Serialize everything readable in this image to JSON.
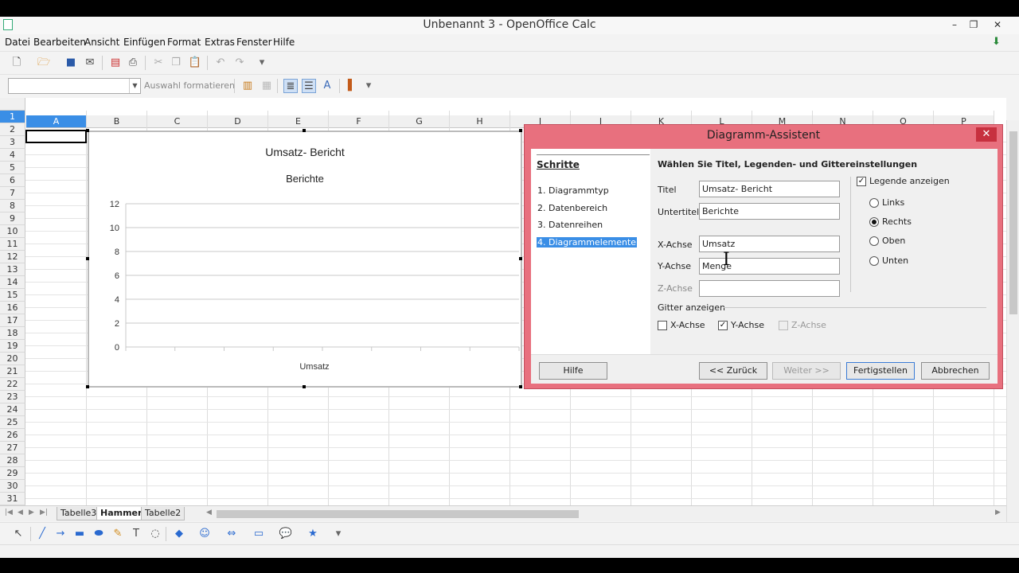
{
  "window": {
    "title": "Unbenannt 3 - OpenOffice Calc",
    "min": "–",
    "restore": "❐",
    "close": "✕"
  },
  "menu": [
    "Datei",
    "Bearbeiten",
    "Ansicht",
    "Einfügen",
    "Format",
    "Extras",
    "Fenster",
    "Hilfe"
  ],
  "toolbar2": {
    "style_value": "",
    "format_label": "Auswahl formatieren"
  },
  "columns": [
    "A",
    "B",
    "C",
    "D",
    "E",
    "F",
    "G",
    "H",
    "I",
    "J",
    "K",
    "L",
    "M",
    "N",
    "O",
    "P"
  ],
  "rows": [
    "1",
    "2",
    "3",
    "4",
    "5",
    "6",
    "7",
    "8",
    "9",
    "10",
    "11",
    "12",
    "13",
    "14",
    "15",
    "16",
    "17",
    "18",
    "19",
    "20",
    "21",
    "22",
    "23",
    "24",
    "25",
    "26",
    "27",
    "28",
    "29",
    "30",
    "31"
  ],
  "chart_data": {
    "type": "bar",
    "title": "Umsatz- Bericht",
    "subtitle": "Berichte",
    "xlabel": "Umsatz",
    "ylabel": "",
    "ylim": [
      0,
      12
    ],
    "yticks": [
      "0",
      "2",
      "4",
      "6",
      "8",
      "10",
      "12"
    ],
    "categories": [],
    "series": [],
    "grid": "y-major"
  },
  "sheet_tabs": [
    "Tabelle3",
    "Hammer",
    "Tabelle2"
  ],
  "dialog": {
    "title": "Diagramm-Assistent",
    "close": "✕",
    "steps_heading": "Schritte",
    "steps": [
      "1. Diagrammtyp",
      "2. Datenbereich",
      "3. Datenreihen",
      "4. Diagrammelemente"
    ],
    "heading": "Wählen Sie Titel, Legenden- und Gittereinstellungen",
    "fields": {
      "titel_label": "Titel",
      "titel_value": "Umsatz- Bericht",
      "untertitel_label": "Untertitel",
      "untertitel_value": "Berichte",
      "xachse_label": "X-Achse",
      "xachse_value": "Umsatz",
      "yachse_label": "Y-Achse",
      "yachse_value": "Menge",
      "zachse_label": "Z-Achse",
      "zachse_value": ""
    },
    "legend_checkbox": "Legende anzeigen",
    "legend_positions": [
      "Links",
      "Rechts",
      "Oben",
      "Unten"
    ],
    "grid_heading": "Gitter anzeigen",
    "grid_options": [
      "X-Achse",
      "Y-Achse",
      "Z-Achse"
    ],
    "buttons": {
      "help": "Hilfe",
      "back": "<< Zurück",
      "next": "Weiter >>",
      "finish": "Fertigstellen",
      "cancel": "Abbrechen"
    }
  }
}
